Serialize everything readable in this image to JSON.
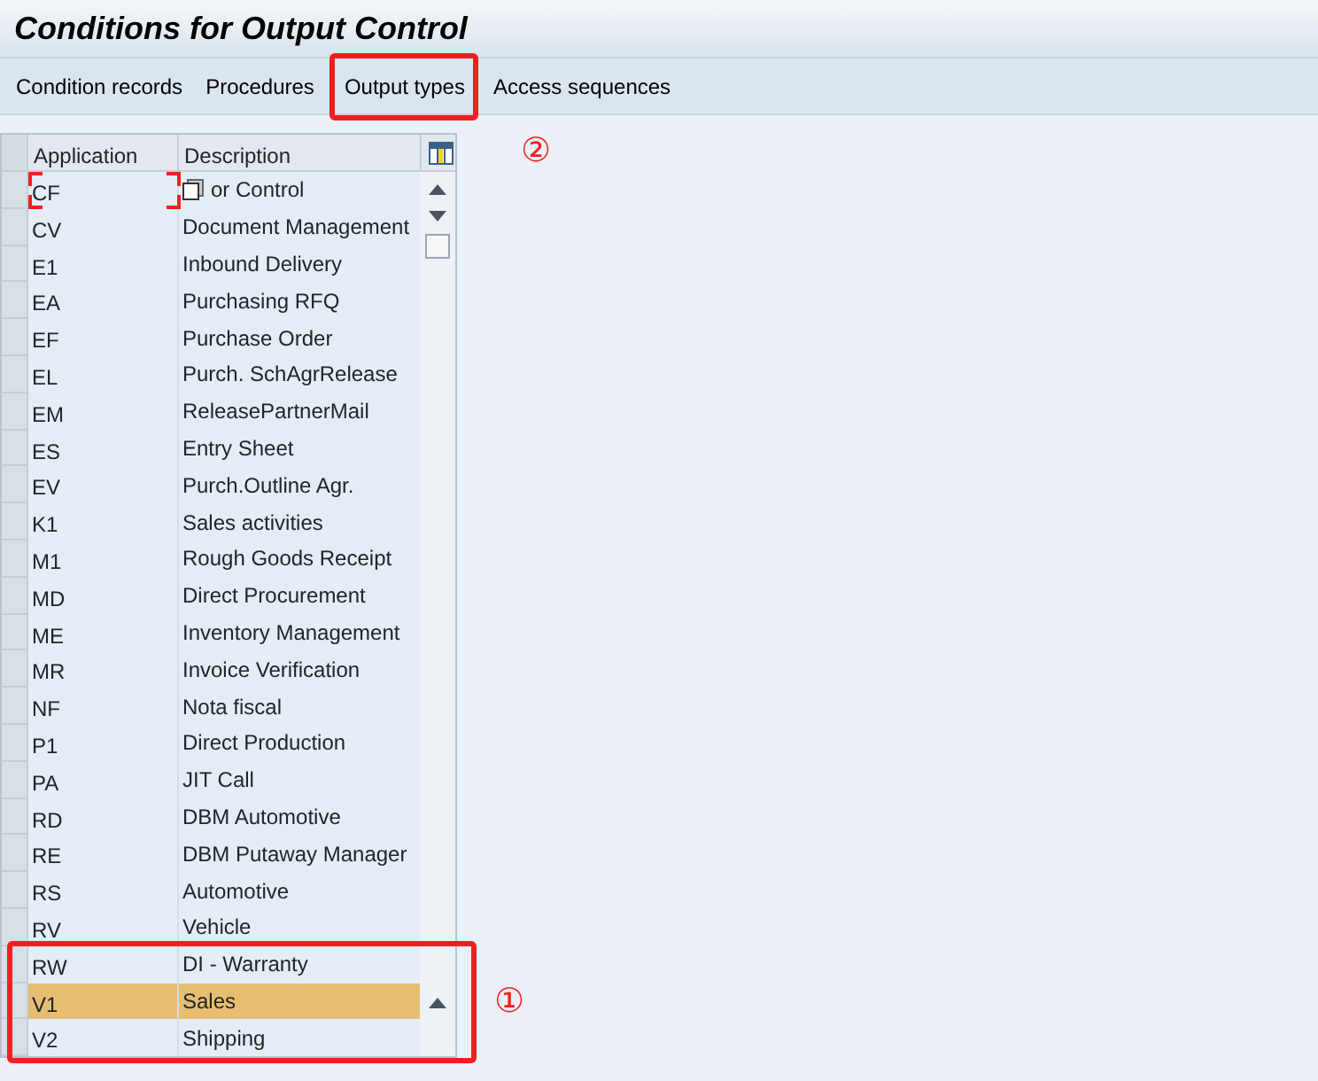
{
  "title": "Conditions for Output Control",
  "toolbar": [
    {
      "label": "Condition records",
      "marked": false
    },
    {
      "label": "Procedures",
      "marked": false
    },
    {
      "label": "Output types",
      "marked": true,
      "callout": "②"
    },
    {
      "label": "Access sequences",
      "marked": false
    }
  ],
  "table": {
    "columns": [
      "Application",
      "Description"
    ],
    "rows": [
      {
        "application": "CF",
        "description": "or Control",
        "selected": false,
        "focused": true
      },
      {
        "application": "CV",
        "description": "Document Management",
        "selected": false
      },
      {
        "application": "E1",
        "description": "Inbound Delivery",
        "selected": false
      },
      {
        "application": "EA",
        "description": "Purchasing RFQ",
        "selected": false
      },
      {
        "application": "EF",
        "description": "Purchase Order",
        "selected": false
      },
      {
        "application": "EL",
        "description": "Purch. SchAgrRelease",
        "selected": false
      },
      {
        "application": "EM",
        "description": "ReleasePartnerMail",
        "selected": false
      },
      {
        "application": "ES",
        "description": "Entry Sheet",
        "selected": false
      },
      {
        "application": "EV",
        "description": "Purch.Outline Agr.",
        "selected": false
      },
      {
        "application": "K1",
        "description": "Sales activities",
        "selected": false
      },
      {
        "application": "M1",
        "description": "Rough Goods Receipt",
        "selected": false
      },
      {
        "application": "MD",
        "description": "Direct Procurement",
        "selected": false
      },
      {
        "application": "ME",
        "description": "Inventory Management",
        "selected": false
      },
      {
        "application": "MR",
        "description": "Invoice Verification",
        "selected": false
      },
      {
        "application": "NF",
        "description": "Nota fiscal",
        "selected": false
      },
      {
        "application": "P1",
        "description": "Direct Production",
        "selected": false
      },
      {
        "application": "PA",
        "description": "JIT Call",
        "selected": false
      },
      {
        "application": "RD",
        "description": "DBM Automotive",
        "selected": false
      },
      {
        "application": "RE",
        "description": "DBM Putaway Manager",
        "selected": false
      },
      {
        "application": "RS",
        "description": "Automotive",
        "selected": false
      },
      {
        "application": "RV",
        "description": "Vehicle",
        "selected": false
      },
      {
        "application": "RW",
        "description": "DI - Warranty",
        "selected": false,
        "marked": true
      },
      {
        "application": "V1",
        "description": "Sales",
        "selected": true,
        "marked": true
      },
      {
        "application": "V2",
        "description": "Shipping",
        "selected": false,
        "marked": true
      }
    ],
    "callout": "①"
  }
}
